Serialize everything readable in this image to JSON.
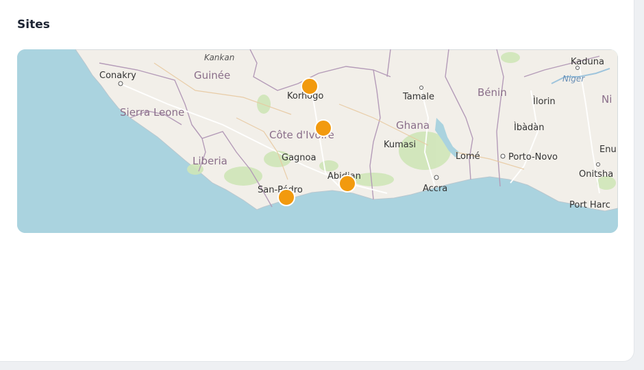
{
  "card": {
    "title": "Sites"
  },
  "map": {
    "countries": {
      "guinee": "Guinée",
      "sierra_leone": "Sierra Leone",
      "liberia": "Liberia",
      "cote_divoire": "Côte d'Ivoire",
      "ghana": "Ghana",
      "benin": "Bénin",
      "nigeria_partial": "Ni"
    },
    "cities": {
      "conakry": "Conakry",
      "korhogo": "Korhogo",
      "tamale": "Tamale",
      "ilorin": "Ìlorin",
      "kaduna": "Kaduna",
      "ibadan": "Ìbàdàn",
      "kumasi": "Kumasi",
      "gagnoa": "Gagnoa",
      "abidjan": "Abidjan",
      "san_pedro": "San-Pédro",
      "lome": "Lomé",
      "porto_novo": "Porto-Novo",
      "accra": "Accra",
      "onitsha": "Onitsha",
      "enu": "Enu",
      "port_harcourt": "Port Harc"
    },
    "regions": {
      "kankan": "Kankan"
    },
    "rivers": {
      "niger": "Niger"
    },
    "marker_color": "#f29a0e",
    "markers": [
      {
        "name": "Korhogo"
      },
      {
        "name": "Côte d'Ivoire center"
      },
      {
        "name": "Abidjan"
      },
      {
        "name": "San-Pédro"
      }
    ]
  }
}
